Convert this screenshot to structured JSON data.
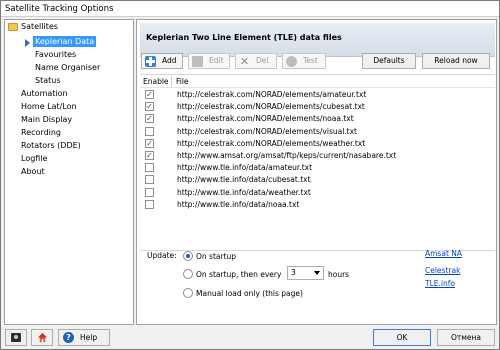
{
  "window": {
    "title": "Satellite Tracking Options"
  },
  "nav": {
    "root": "Satellites",
    "children": [
      "Keplerian Data",
      "Favourites",
      "Name Organiser",
      "Status"
    ],
    "items": [
      "Automation",
      "Home Lat/Lon",
      "Main Display",
      "Recording",
      "Rotators (DDE)",
      "Logfile",
      "About"
    ]
  },
  "panel": {
    "header": "Keplerian Two Line Element (TLE) data files"
  },
  "toolbar": {
    "add": "Add",
    "edit": "Edit",
    "del": "Del",
    "test": "Test",
    "defaults": "Defaults",
    "reload": "Reload now"
  },
  "list": {
    "columns": [
      "Enable",
      "File"
    ],
    "rows": [
      {
        "checked": true,
        "url": "http://celestrak.com/NORAD/elements/amateur.txt"
      },
      {
        "checked": true,
        "url": "http://celestrak.com/NORAD/elements/cubesat.txt"
      },
      {
        "checked": true,
        "url": "http://celestrak.com/NORAD/elements/noaa.txt"
      },
      {
        "checked": false,
        "url": "http://celestrak.com/NORAD/elements/visual.txt"
      },
      {
        "checked": true,
        "url": "http://celestrak.com/NORAD/elements/weather.txt"
      },
      {
        "checked": true,
        "url": "http://www.amsat.org/amsat/ftp/keps/current/nasabare.txt"
      },
      {
        "checked": false,
        "url": "http://www.tle.info/data/amateur.txt"
      },
      {
        "checked": false,
        "url": "http://www.tle.info/data/cubesat.txt"
      },
      {
        "checked": false,
        "url": "http://www.tle.info/data/weather.txt"
      },
      {
        "checked": false,
        "url": "http://www.tle.info/data/noaa.txt"
      }
    ]
  },
  "update": {
    "label": "Update:",
    "on_startup": "On startup",
    "every_prefix": "On startup, then every",
    "every_value": "3",
    "every_suffix": "hours",
    "manual": "Manual load only (this page)",
    "selected": "on_startup"
  },
  "links": [
    "Amsat NA",
    "Celestrak",
    "TLE.info"
  ],
  "footer": {
    "help": "Help",
    "ok": "OK",
    "cancel": "Отмена"
  }
}
